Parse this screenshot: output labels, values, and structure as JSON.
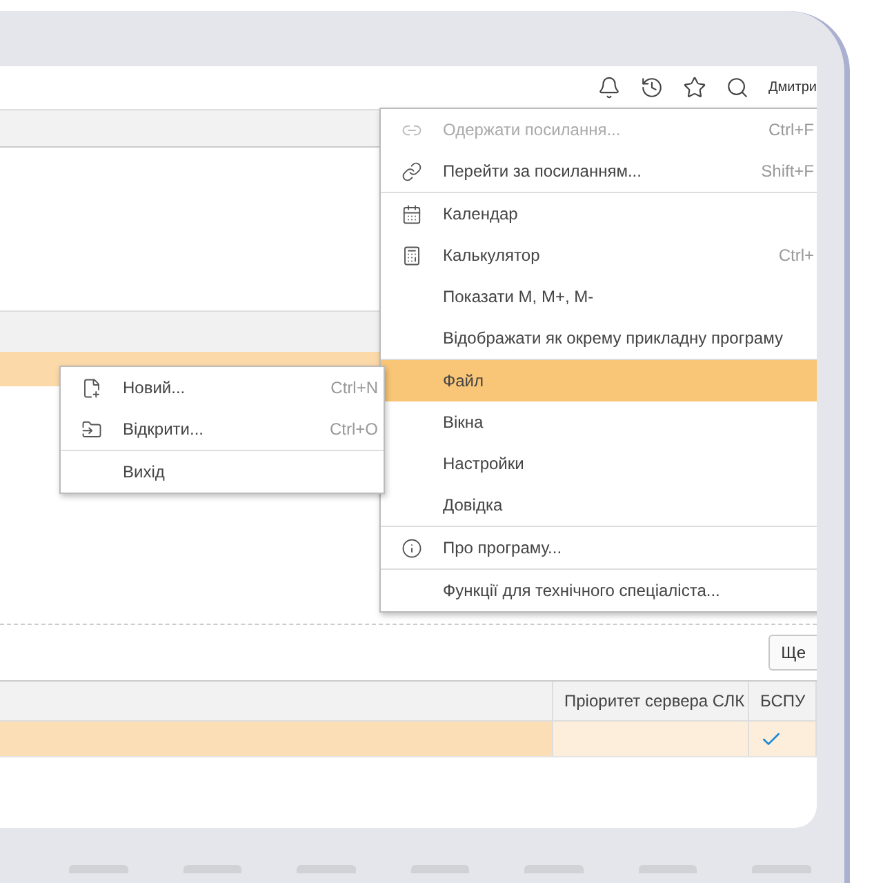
{
  "top_bar": {
    "user": "Дмитри"
  },
  "background_list": {
    "rows": [
      {
        "selected": true
      }
    ]
  },
  "main_menu": [
    {
      "kind": "item",
      "label": "Одержати посилання...",
      "shortcut": "Ctrl+F",
      "disabled": true,
      "selected": false
    },
    {
      "kind": "item",
      "label": "Перейти за посиланням...",
      "shortcut": "Shift+F",
      "disabled": false,
      "selected": false
    },
    {
      "kind": "separator"
    },
    {
      "kind": "item",
      "label": "Календар",
      "disabled": false,
      "selected": false
    },
    {
      "kind": "item",
      "label": "Калькулятор",
      "shortcut": "Ctrl+",
      "disabled": false,
      "selected": false
    },
    {
      "kind": "item",
      "label": "Показати M, M+, M-",
      "disabled": false,
      "selected": false
    },
    {
      "kind": "item",
      "label": "Відображати як окрему прикладну програму",
      "disabled": false,
      "selected": false
    },
    {
      "kind": "separator"
    },
    {
      "kind": "item",
      "label": "Файл",
      "disabled": false,
      "selected": true
    },
    {
      "kind": "item",
      "label": "Вікна",
      "disabled": false,
      "selected": false
    },
    {
      "kind": "item",
      "label": "Настройки",
      "disabled": false,
      "selected": false
    },
    {
      "kind": "item",
      "label": "Довідка",
      "disabled": false,
      "selected": false
    },
    {
      "kind": "separator"
    },
    {
      "kind": "item",
      "label": "Про програму...",
      "disabled": false,
      "selected": false
    },
    {
      "kind": "separator"
    },
    {
      "kind": "item",
      "label": "Функції для технічного спеціаліста...",
      "disabled": false,
      "selected": false
    }
  ],
  "sub_menu": [
    {
      "kind": "item",
      "label": "Новий...",
      "shortcut": "Ctrl+N",
      "disabled": false,
      "selected": false
    },
    {
      "kind": "item",
      "label": "Відкрити...",
      "shortcut": "Ctrl+O",
      "disabled": false,
      "selected": false
    },
    {
      "kind": "separator"
    },
    {
      "kind": "item",
      "label": "Вихід",
      "disabled": false,
      "selected": false
    }
  ],
  "more_button": "Ще",
  "table": {
    "columns": [
      {
        "label": "Пріоритет сервера СЛК"
      },
      {
        "label": "БСПУ"
      }
    ],
    "rows": [
      {
        "selected": true,
        "checked": true
      }
    ]
  }
}
